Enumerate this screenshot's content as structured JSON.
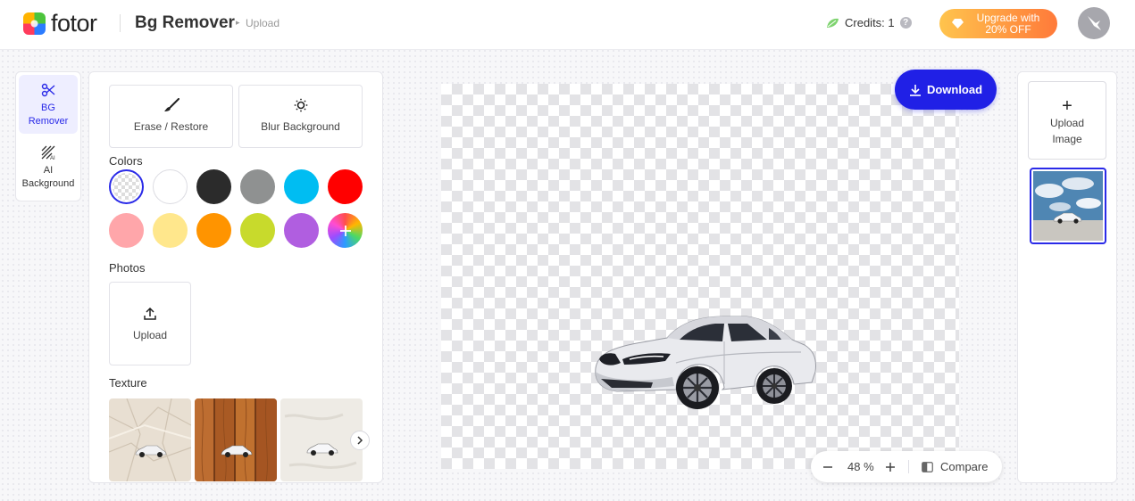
{
  "header": {
    "logo_text": "fotor",
    "page_title": "Bg Remover",
    "breadcrumb": "Upload",
    "credits_label": "Credits: 1",
    "help_glyph": "?",
    "upgrade_line1": "Upgrade with",
    "upgrade_line2": "20% OFF"
  },
  "rail": {
    "items": [
      {
        "line1": "BG",
        "line2": "Remover",
        "icon": "scissors-icon",
        "active": true
      },
      {
        "line1": "AI",
        "line2": "Background",
        "icon": "ai-background-icon",
        "active": false
      }
    ]
  },
  "panel": {
    "tools": [
      {
        "label": "Erase / Restore",
        "icon": "brush-icon"
      },
      {
        "label": "Blur Background",
        "icon": "blur-icon"
      }
    ],
    "colors_label": "Colors",
    "colors": [
      "transparent",
      "#ffffff",
      "#2b2b2b",
      "#8f9191",
      "#00bdf2",
      "#ff0000",
      "#ffa6aa",
      "#ffe78c",
      "#ff9400",
      "#c8da2c",
      "#b05ee0",
      "custom"
    ],
    "photos_label": "Photos",
    "upload_label": "Upload",
    "texture_label": "Texture",
    "textures": [
      "crumpled-paper",
      "wood",
      "plaster"
    ]
  },
  "canvas": {
    "download_label": "Download",
    "zoom_value": "48 %",
    "compare_label": "Compare"
  },
  "right_panel": {
    "upload_line1": "Upload",
    "upload_line2": "Image"
  },
  "colors": {
    "accent": "#2a2ae8",
    "download": "#2020e6",
    "upgrade_start": "#ffc44d",
    "upgrade_end": "#ff7a3a"
  }
}
